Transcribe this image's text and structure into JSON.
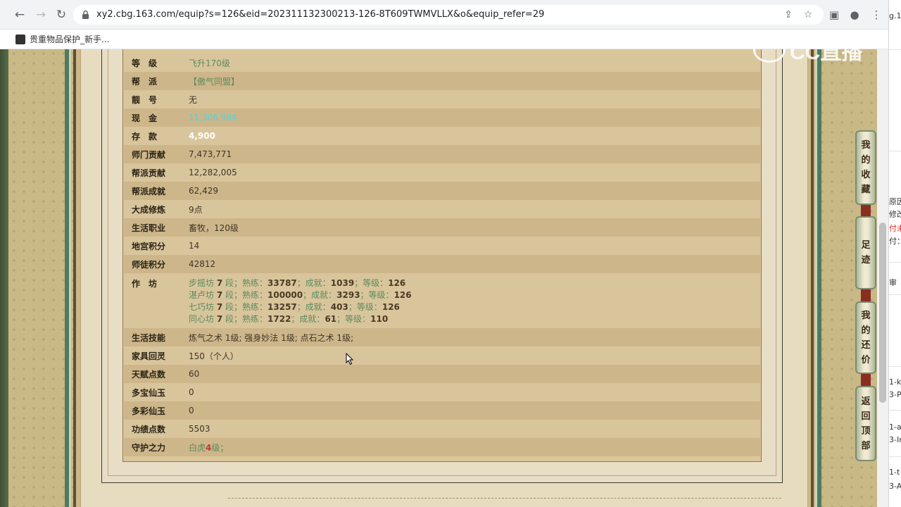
{
  "browser": {
    "url": "xy2.cbg.163.com/equip?s=126&eid=202311132300213-126-8T609TWMVLLX&o&equip_refer=29",
    "bookmark_label": "贵重物品保护_新手..."
  },
  "watermark": {
    "text": "CC直播"
  },
  "table": {
    "rows": [
      {
        "label": "等　级",
        "value": "飞升170级",
        "style": "green"
      },
      {
        "label": "帮　派",
        "value": "【傲气同盟】",
        "style": "green"
      },
      {
        "label": "靓　号",
        "value": "无",
        "style": "normal"
      },
      {
        "label": "现　金",
        "value": "11,306,984",
        "style": "cyan"
      },
      {
        "label": "存　款",
        "value": "4,900",
        "style": "white"
      },
      {
        "label": "师门贡献",
        "value": "7,473,771",
        "style": "normal"
      },
      {
        "label": "帮派贡献",
        "value": "12,282,005",
        "style": "normal"
      },
      {
        "label": "帮派成就",
        "value": "62,429",
        "style": "normal"
      },
      {
        "label": "大成修炼",
        "value": "9点",
        "style": "normal"
      },
      {
        "label": "生活职业",
        "value": "畜牧，120级",
        "style": "normal"
      },
      {
        "label": "地宫积分",
        "value": "14",
        "style": "normal"
      },
      {
        "label": "师徒积分",
        "value": "42812",
        "style": "normal"
      }
    ],
    "workshop": {
      "label": "作　坊",
      "lines": [
        {
          "name": "步摇坊",
          "level": "7",
          "seg": "段；熟练：",
          "skill": "33787",
          "ach_label": "；成就：",
          "ach": "1039",
          "grade_label": "；等级：",
          "grade": "126"
        },
        {
          "name": "湛卢坊",
          "level": "7",
          "seg": "段；熟练：",
          "skill": "100000",
          "ach_label": "；成就：",
          "ach": "3293",
          "grade_label": "；等级：",
          "grade": "126"
        },
        {
          "name": "七巧坊",
          "level": "7",
          "seg": "段；熟练：",
          "skill": "13257",
          "ach_label": "；成就：",
          "ach": "403",
          "grade_label": "；等级：",
          "grade": "126"
        },
        {
          "name": "同心坊",
          "level": "7",
          "seg": "段；熟练：",
          "skill": "1722",
          "ach_label": "；成就：",
          "ach": "61",
          "grade_label": "；等级：",
          "grade": "110"
        }
      ]
    },
    "rows_after": [
      {
        "label": "生活技能",
        "value": "炼气之术 1级; 强身妙法 1级; 点石之术 1级;",
        "style": "normal"
      },
      {
        "label": "家具回灵",
        "value": "150（个人）",
        "style": "normal"
      },
      {
        "label": "天赋点数",
        "value": "60",
        "style": "normal"
      },
      {
        "label": "多宝仙玉",
        "value": "0",
        "style": "normal"
      },
      {
        "label": "多彩仙玉",
        "value": "0",
        "style": "normal"
      },
      {
        "label": "功绩点数",
        "value": "5503",
        "style": "normal"
      },
      {
        "label": "守护之力",
        "value_prefix": "白虎",
        "value_num": "4",
        "value_suffix": "级；",
        "style": "green"
      }
    ]
  },
  "float_nav": [
    {
      "label": "我\n的\n收\n藏"
    },
    {
      "label": "足\n迹"
    },
    {
      "label": "我\n的\n还\n价"
    },
    {
      "label": "返\n回\n顶\n部"
    }
  ],
  "side_window": {
    "texts": [
      "g.1",
      "原因",
      "修改",
      "付未",
      "付：",
      "审",
      "1-k",
      "3-P",
      "1-a",
      "3-Ir",
      "1-t",
      "3-A"
    ]
  }
}
